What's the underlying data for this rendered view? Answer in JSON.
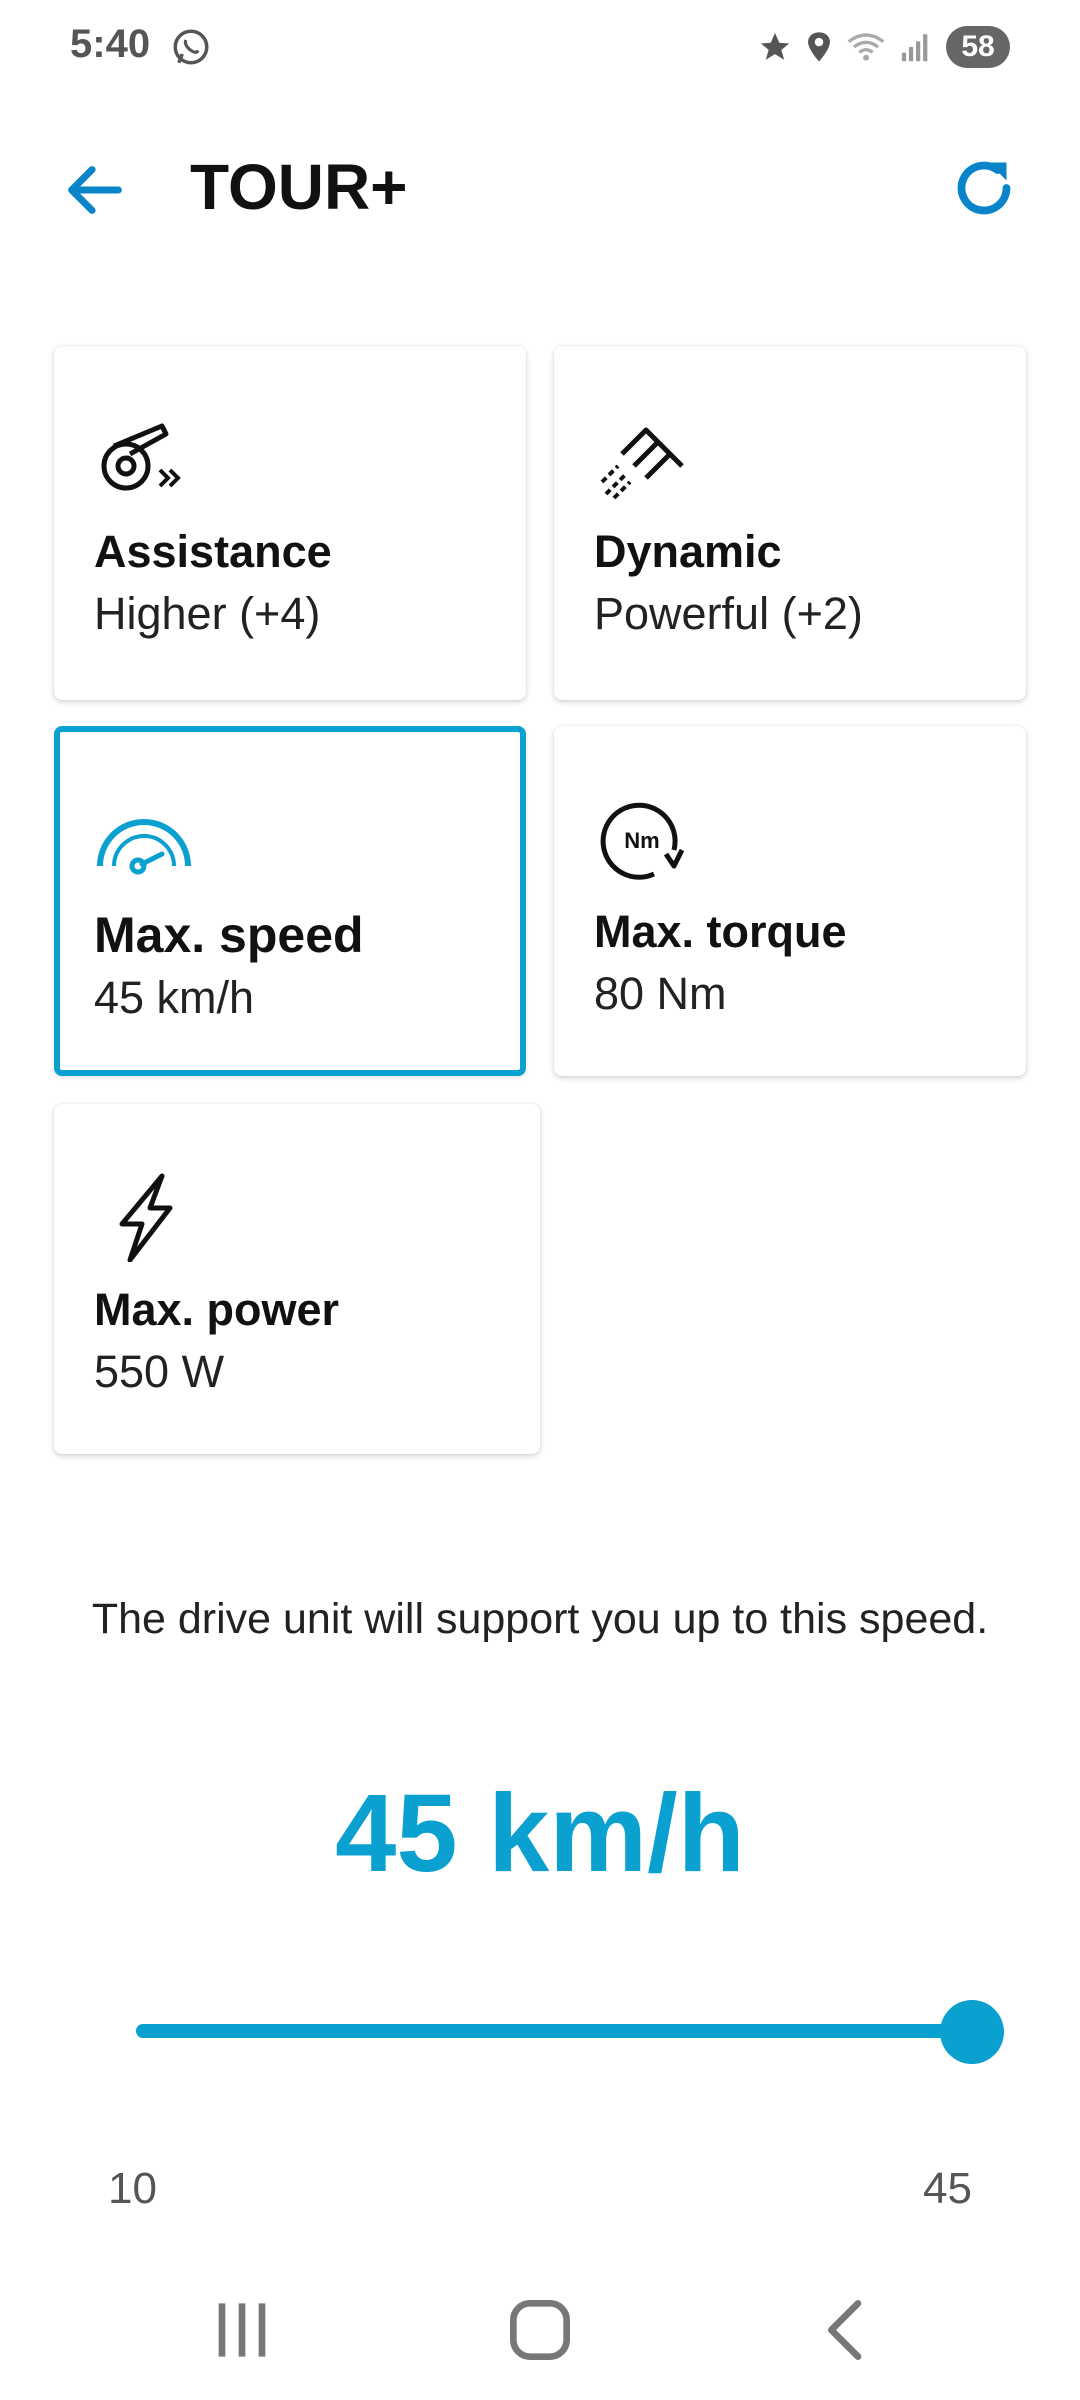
{
  "status_bar": {
    "time": "5:40",
    "battery": "58"
  },
  "app_bar": {
    "title": "TOUR+"
  },
  "cards": {
    "assistance": {
      "label": "Assistance",
      "value": "Higher (+4)"
    },
    "dynamic": {
      "label": "Dynamic",
      "value": "Powerful (+2)"
    },
    "max_speed": {
      "label": "Max. speed",
      "value": "45 km/h"
    },
    "max_torque": {
      "label": "Max. torque",
      "value": "80 Nm",
      "icon_text": "Nm"
    },
    "max_power": {
      "label": "Max. power",
      "value": "550 W"
    }
  },
  "detail": {
    "description": "The drive unit will support you up to this speed.",
    "current_value": "45 km/h"
  },
  "slider": {
    "min": "10",
    "max": "45",
    "value": 45,
    "min_value": 10,
    "max_value": 45
  },
  "colors": {
    "accent": "#0aa0d0",
    "text": "#111111",
    "muted": "#555555"
  }
}
